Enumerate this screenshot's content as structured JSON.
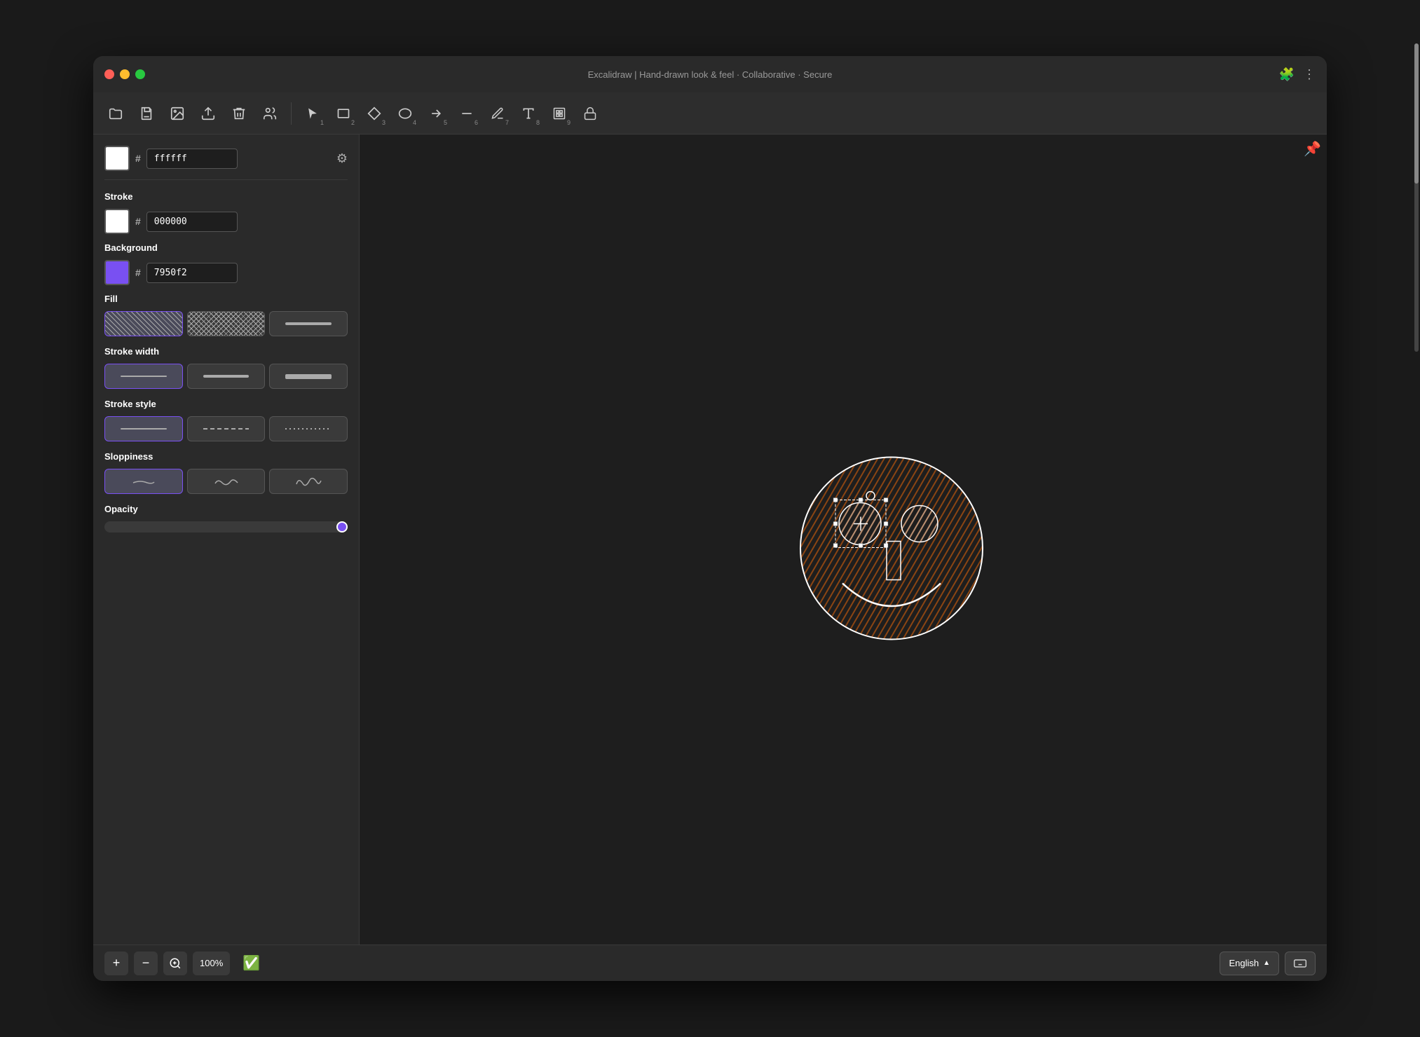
{
  "window": {
    "title": "Excalidraw | Hand-drawn look & feel · Collaborative · Secure",
    "traffic_lights": [
      "close",
      "minimize",
      "maximize"
    ]
  },
  "titlebar": {
    "title": "Excalidraw | Hand-drawn look & feel · Collaborative · Secure",
    "plugin_icon": "🧩",
    "menu_icon": "⋮"
  },
  "toolbar": {
    "tools": [
      {
        "id": "select",
        "icon": "↖",
        "shortcut": "1",
        "active": false
      },
      {
        "id": "rectangle",
        "icon": "□",
        "shortcut": "2",
        "active": false
      },
      {
        "id": "diamond",
        "icon": "◇",
        "shortcut": "3",
        "active": false
      },
      {
        "id": "ellipse",
        "icon": "○",
        "shortcut": "4",
        "active": false
      },
      {
        "id": "arrow",
        "icon": "→",
        "shortcut": "5",
        "active": false
      },
      {
        "id": "line",
        "icon": "—",
        "shortcut": "6",
        "active": false
      },
      {
        "id": "pencil",
        "icon": "✏",
        "shortcut": "7",
        "active": false
      },
      {
        "id": "text",
        "icon": "A",
        "shortcut": "8",
        "active": false
      },
      {
        "id": "image",
        "icon": "⊞",
        "shortcut": "9",
        "active": false
      },
      {
        "id": "lock",
        "icon": "🔓",
        "shortcut": "",
        "active": false
      }
    ],
    "file_tools": [
      {
        "id": "open",
        "icon": "📂"
      },
      {
        "id": "save",
        "icon": "💾"
      },
      {
        "id": "export-image",
        "icon": "🖼"
      },
      {
        "id": "export-scene",
        "icon": "📤"
      },
      {
        "id": "clear",
        "icon": "🗑"
      },
      {
        "id": "collaborate",
        "icon": "👥"
      }
    ]
  },
  "sidebar": {
    "background_label": "Background",
    "background_hex_symbol": "#",
    "background_color_value": "ffffff",
    "background_settings_icon": "⚙",
    "stroke_label": "Stroke",
    "stroke_hex_symbol": "#",
    "stroke_color_value": "000000",
    "bg_label": "Background",
    "bg_hex_symbol": "#",
    "bg_color_value": "7950f2",
    "fill_label": "Fill",
    "fill_options": [
      {
        "id": "hatch",
        "label": "hatch"
      },
      {
        "id": "cross-hatch",
        "label": "cross-hatch"
      },
      {
        "id": "solid",
        "label": "solid"
      }
    ],
    "stroke_width_label": "Stroke width",
    "stroke_width_options": [
      {
        "id": "thin",
        "label": "thin"
      },
      {
        "id": "medium",
        "label": "medium"
      },
      {
        "id": "thick",
        "label": "thick"
      }
    ],
    "stroke_style_label": "Stroke style",
    "stroke_style_options": [
      {
        "id": "solid",
        "label": "solid"
      },
      {
        "id": "dashed",
        "label": "dashed"
      },
      {
        "id": "dotted",
        "label": "dotted"
      }
    ],
    "sloppiness_label": "Sloppiness",
    "sloppiness_options": [
      {
        "id": "architect",
        "label": "architect"
      },
      {
        "id": "artist",
        "label": "artist"
      },
      {
        "id": "cartoonist",
        "label": "cartoonist"
      }
    ],
    "opacity_label": "Opacity"
  },
  "bottom_bar": {
    "zoom_in_label": "+",
    "zoom_out_label": "−",
    "zoom_fit_icon": "⊙",
    "zoom_level": "100%",
    "status_icon": "✅",
    "language": "English",
    "lang_arrow": "▲",
    "keyboard_icon": "⌨"
  }
}
